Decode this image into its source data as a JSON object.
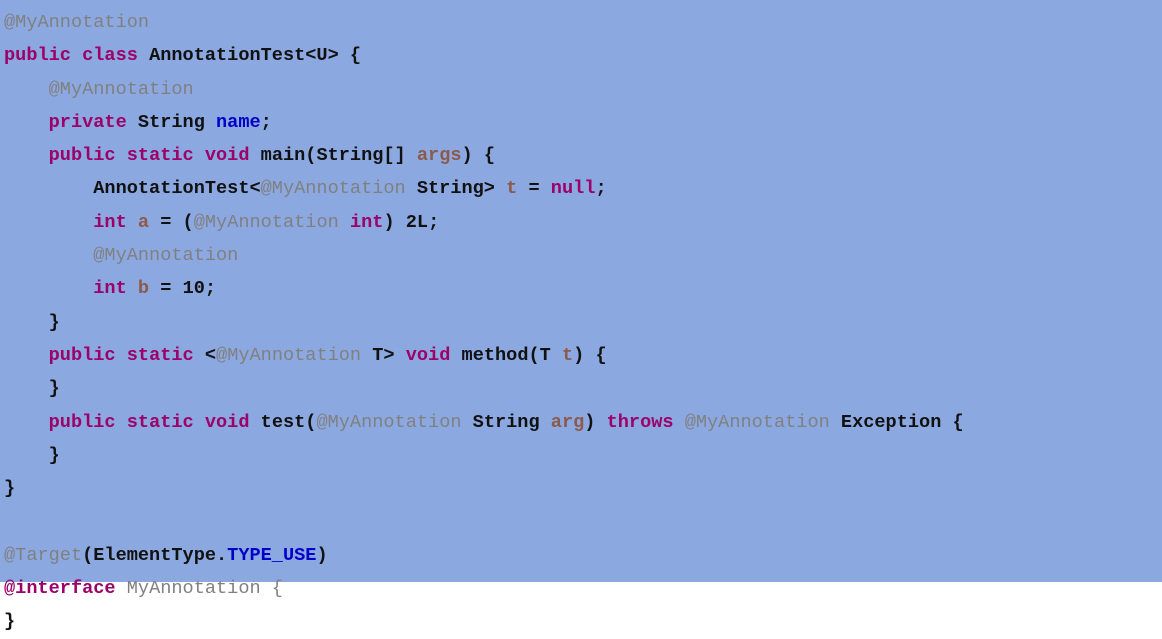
{
  "editor": {
    "language": "Java",
    "background_color": "#8ca8e0",
    "font_size_px": 18.6,
    "line_height_px": 33.3,
    "line_count": 17,
    "indent_unit": "4 spaces"
  },
  "palette": {
    "keyword": "#9b0069",
    "annotation": "#808080",
    "identifier": "#111111",
    "field": "#0000c8",
    "constant": "#0000c8",
    "parameter": "#8c5a4b",
    "number": "#111111",
    "background": "#8ca8e0"
  },
  "code": {
    "full_text": "@MyAnnotation\npublic class AnnotationTest<U> {\n    @MyAnnotation\n    private String name;\n    public static void main(String[] args) {\n        AnnotationTest<@MyAnnotation String> t = null;\n        int a = (@MyAnnotation int) 2L;\n        @MyAnnotation\n        int b = 10;\n    }\n    public static <@MyAnnotation T> void method(T t) {\n    }\n    public static void test(@MyAnnotation String arg) throws @MyAnnotation Exception {\n    }\n}\n\n@Target(ElementType.TYPE_USE)\n@interface MyAnnotation {\n}",
    "lines": [
      {
        "n": 1,
        "tokens": [
          {
            "t": "@MyAnnotation",
            "c": "tok-ann"
          }
        ]
      },
      {
        "n": 2,
        "tokens": [
          {
            "t": "public class ",
            "c": "tok-kw"
          },
          {
            "t": "AnnotationTest<U> {",
            "c": "tok-type"
          }
        ]
      },
      {
        "n": 3,
        "tokens": [
          {
            "t": "    ",
            "c": "tok-blank"
          },
          {
            "t": "@MyAnnotation",
            "c": "tok-ann"
          }
        ]
      },
      {
        "n": 4,
        "tokens": [
          {
            "t": "    ",
            "c": "tok-blank"
          },
          {
            "t": "private ",
            "c": "tok-kw"
          },
          {
            "t": "String ",
            "c": "tok-type"
          },
          {
            "t": "name",
            "c": "tok-field"
          },
          {
            "t": ";",
            "c": "tok-punct"
          }
        ]
      },
      {
        "n": 5,
        "tokens": [
          {
            "t": "    ",
            "c": "tok-blank"
          },
          {
            "t": "public static void ",
            "c": "tok-kw"
          },
          {
            "t": "main(String[] ",
            "c": "tok-type"
          },
          {
            "t": "args",
            "c": "tok-param"
          },
          {
            "t": ") {",
            "c": "tok-punct"
          }
        ]
      },
      {
        "n": 6,
        "tokens": [
          {
            "t": "        ",
            "c": "tok-blank"
          },
          {
            "t": "AnnotationTest<",
            "c": "tok-plain"
          },
          {
            "t": "@MyAnnotation",
            "c": "tok-ann"
          },
          {
            "t": " String> ",
            "c": "tok-plain"
          },
          {
            "t": "t",
            "c": "tok-param"
          },
          {
            "t": " = ",
            "c": "tok-punct"
          },
          {
            "t": "null",
            "c": "tok-kw"
          },
          {
            "t": ";",
            "c": "tok-punct"
          }
        ]
      },
      {
        "n": 7,
        "tokens": [
          {
            "t": "        ",
            "c": "tok-blank"
          },
          {
            "t": "int ",
            "c": "tok-kw"
          },
          {
            "t": "a",
            "c": "tok-param"
          },
          {
            "t": " = (",
            "c": "tok-punct"
          },
          {
            "t": "@MyAnnotation",
            "c": "tok-ann"
          },
          {
            "t": " ",
            "c": "tok-blank"
          },
          {
            "t": "int",
            "c": "tok-kw"
          },
          {
            "t": ") ",
            "c": "tok-punct"
          },
          {
            "t": "2L",
            "c": "tok-num"
          },
          {
            "t": ";",
            "c": "tok-punct"
          }
        ]
      },
      {
        "n": 8,
        "tokens": [
          {
            "t": "        ",
            "c": "tok-blank"
          },
          {
            "t": "@MyAnnotation",
            "c": "tok-ann"
          }
        ]
      },
      {
        "n": 9,
        "tokens": [
          {
            "t": "        ",
            "c": "tok-blank"
          },
          {
            "t": "int ",
            "c": "tok-kw"
          },
          {
            "t": "b",
            "c": "tok-param"
          },
          {
            "t": " = ",
            "c": "tok-punct"
          },
          {
            "t": "10",
            "c": "tok-num"
          },
          {
            "t": ";",
            "c": "tok-punct"
          }
        ]
      },
      {
        "n": 10,
        "tokens": [
          {
            "t": "    ",
            "c": "tok-blank"
          },
          {
            "t": "}",
            "c": "tok-punct"
          }
        ]
      },
      {
        "n": 11,
        "tokens": [
          {
            "t": "    ",
            "c": "tok-blank"
          },
          {
            "t": "public static ",
            "c": "tok-kw"
          },
          {
            "t": "<",
            "c": "tok-plain"
          },
          {
            "t": "@MyAnnotation",
            "c": "tok-ann"
          },
          {
            "t": " T> ",
            "c": "tok-plain"
          },
          {
            "t": "void ",
            "c": "tok-kw"
          },
          {
            "t": "method(T ",
            "c": "tok-type"
          },
          {
            "t": "t",
            "c": "tok-param"
          },
          {
            "t": ") {",
            "c": "tok-punct"
          }
        ]
      },
      {
        "n": 12,
        "tokens": [
          {
            "t": "    ",
            "c": "tok-blank"
          },
          {
            "t": "}",
            "c": "tok-punct"
          }
        ]
      },
      {
        "n": 13,
        "tokens": [
          {
            "t": "    ",
            "c": "tok-blank"
          },
          {
            "t": "public static void ",
            "c": "tok-kw"
          },
          {
            "t": "test(",
            "c": "tok-type"
          },
          {
            "t": "@MyAnnotation",
            "c": "tok-ann"
          },
          {
            "t": " String ",
            "c": "tok-type"
          },
          {
            "t": "arg",
            "c": "tok-param"
          },
          {
            "t": ") ",
            "c": "tok-punct"
          },
          {
            "t": "throws ",
            "c": "tok-kw"
          },
          {
            "t": "@MyAnnotation",
            "c": "tok-ann"
          },
          {
            "t": " Exception {",
            "c": "tok-type"
          }
        ]
      },
      {
        "n": 14,
        "tokens": [
          {
            "t": "    ",
            "c": "tok-blank"
          },
          {
            "t": "}",
            "c": "tok-punct"
          }
        ]
      },
      {
        "n": 15,
        "tokens": [
          {
            "t": "}",
            "c": "tok-punct"
          }
        ]
      },
      {
        "n": 16,
        "tokens": []
      },
      {
        "n": 17,
        "tokens": [
          {
            "t": "@Target",
            "c": "tok-ann"
          },
          {
            "t": "(ElementType.",
            "c": "tok-plain"
          },
          {
            "t": "TYPE_USE",
            "c": "tok-const"
          },
          {
            "t": ")",
            "c": "tok-plain"
          }
        ]
      },
      {
        "n": 18,
        "tokens": [
          {
            "t": "@interface ",
            "c": "tok-kw"
          },
          {
            "t": "MyAnnotation {",
            "c": "tok-ann"
          }
        ]
      },
      {
        "n": 19,
        "tokens": [
          {
            "t": "}",
            "c": "tok-punct"
          }
        ]
      }
    ]
  }
}
